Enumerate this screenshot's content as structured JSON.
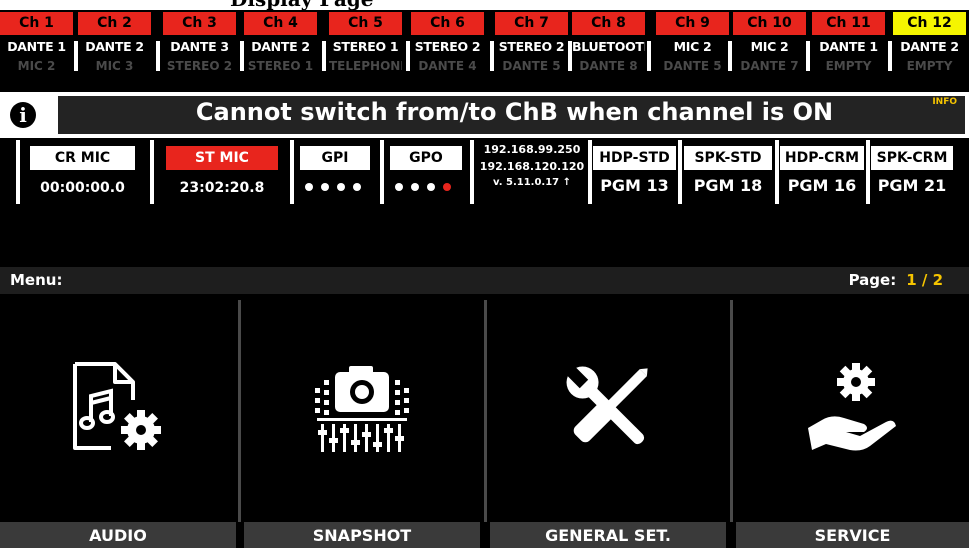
{
  "top_strip_text": "Display Page",
  "channels": [
    {
      "num": "Ch 1",
      "name": "DANTE 1",
      "sub": "MIC 2",
      "highlight": "red"
    },
    {
      "num": "Ch 2",
      "name": "DANTE 2",
      "sub": "MIC 3",
      "highlight": "red"
    },
    {
      "num": "Ch 3",
      "name": "DANTE 3",
      "sub": "STEREO 2",
      "highlight": "red"
    },
    {
      "num": "Ch 4",
      "name": "DANTE 2",
      "sub": "STEREO 1",
      "highlight": "red"
    },
    {
      "num": "Ch 5",
      "name": "STEREO 1",
      "sub": "TELEPHONE",
      "highlight": "red"
    },
    {
      "num": "Ch 6",
      "name": "STEREO 2",
      "sub": "DANTE 4",
      "highlight": "red"
    },
    {
      "num": "Ch 7",
      "name": "STEREO 2",
      "sub": "DANTE 5",
      "highlight": "red"
    },
    {
      "num": "Ch 8",
      "name": "BLUETOOTH",
      "sub": "DANTE 8",
      "highlight": "red"
    },
    {
      "num": "Ch 9",
      "name": "MIC 2",
      "sub": "DANTE 5",
      "highlight": "red"
    },
    {
      "num": "Ch 10",
      "name": "MIC 2",
      "sub": "DANTE 7",
      "highlight": "red"
    },
    {
      "num": "Ch 11",
      "name": "DANTE 1",
      "sub": "EMPTY",
      "highlight": "red"
    },
    {
      "num": "Ch 12",
      "name": "DANTE 2",
      "sub": "EMPTY",
      "highlight": "yellow"
    }
  ],
  "banner": {
    "icon": "info-icon",
    "message": "Cannot switch from/to ChB when channel is ON",
    "tag": "INFO"
  },
  "status": {
    "cr_mic": {
      "label": "CR MIC",
      "time": "00:00:00.0"
    },
    "st_mic": {
      "label": "ST MIC",
      "time": "23:02:20.8"
    },
    "gpi": {
      "label": "GPI",
      "states": [
        "off",
        "off",
        "off",
        "off"
      ]
    },
    "gpo": {
      "label": "GPO",
      "states": [
        "off",
        "off",
        "off",
        "on"
      ]
    },
    "network": {
      "ip1": "192.168.99.250",
      "ip2": "192.168.120.120",
      "version": "v. 5.11.0.17 ↑"
    },
    "monitors": [
      {
        "label": "HDP-STD",
        "pgm": "PGM 13"
      },
      {
        "label": "SPK-STD",
        "pgm": "PGM 18"
      },
      {
        "label": "HDP-CRM",
        "pgm": "PGM 16"
      },
      {
        "label": "SPK-CRM",
        "pgm": "PGM 21"
      }
    ]
  },
  "menu": {
    "label": "Menu:",
    "page_label": "Page:",
    "page_value": "1 / 2",
    "tiles": [
      {
        "label": "AUDIO",
        "icon": "audio-settings-icon"
      },
      {
        "label": "SNAPSHOT",
        "icon": "snapshot-camera-icon"
      },
      {
        "label": "GENERAL SET.",
        "icon": "tools-icon"
      },
      {
        "label": "SERVICE",
        "icon": "service-hand-icon"
      }
    ]
  },
  "colors": {
    "accent_red": "#e8251d",
    "accent_yellow": "#f5f500",
    "page_yellow": "#f5c400"
  }
}
